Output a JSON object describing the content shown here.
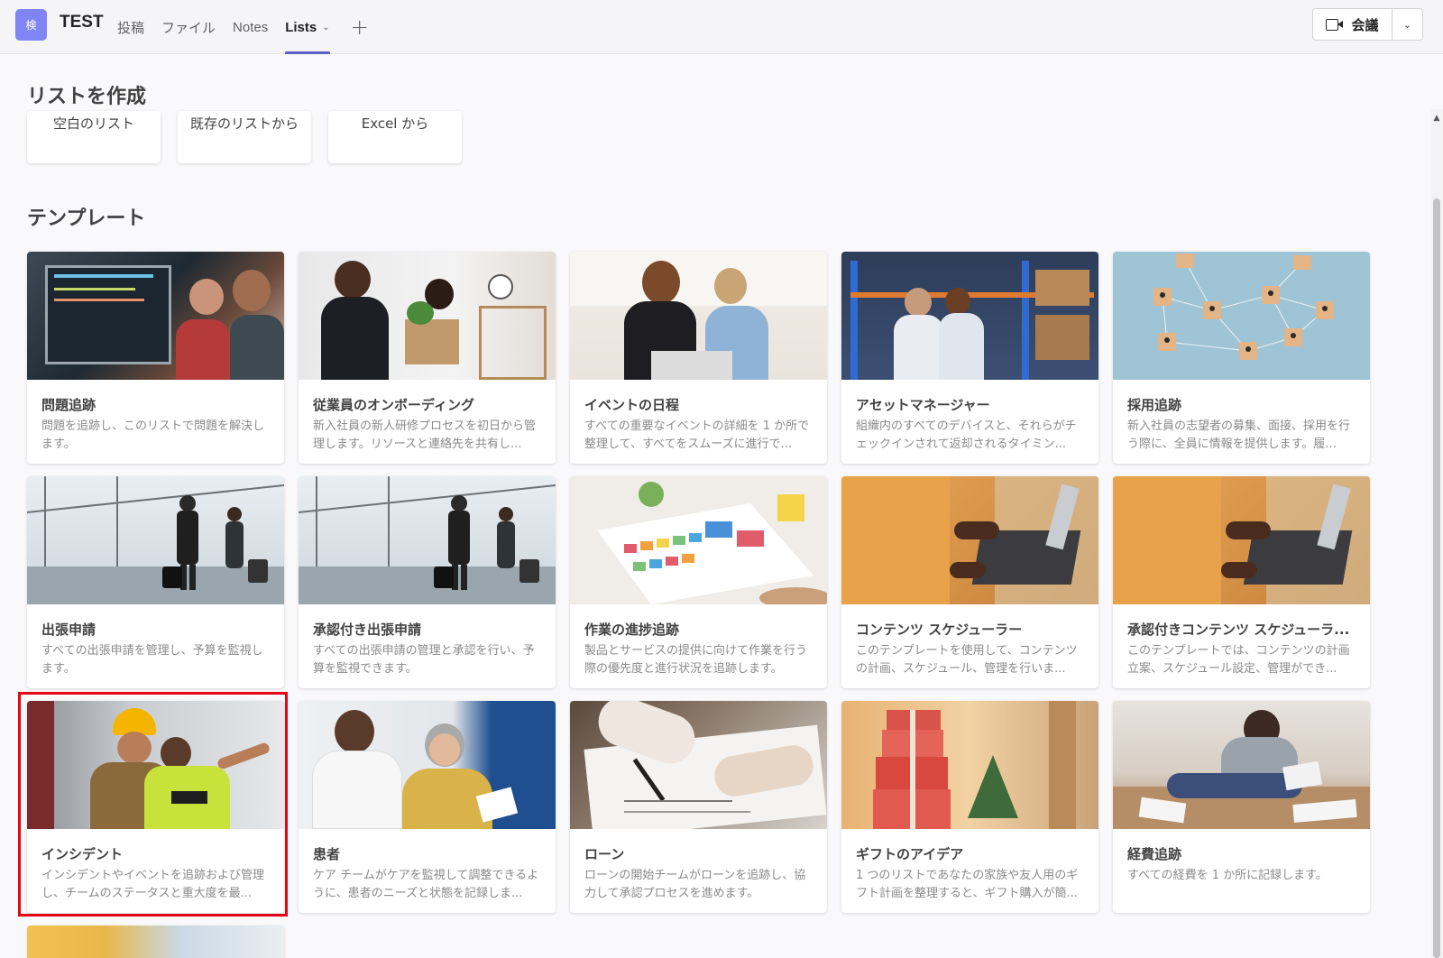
{
  "header": {
    "app_avatar": "検",
    "team_name": "TEST",
    "tabs": [
      {
        "label": "投稿"
      },
      {
        "label": "ファイル"
      },
      {
        "label": "Notes"
      },
      {
        "label": "Lists",
        "active": true
      }
    ],
    "add_tab_icon": "plus-icon",
    "meet_label": "会議"
  },
  "create": {
    "title": "リストを作成",
    "options": [
      "空白のリスト",
      "既存のリストから",
      "Excel から"
    ]
  },
  "templates": {
    "title": "テンプレート",
    "items": [
      {
        "title": "問題追跡",
        "desc": "問題を追跡し、このリストで問題を解決します。"
      },
      {
        "title": "従業員のオンボーディング",
        "desc": "新入社員の新人研修プロセスを初日から管理します。リソースと連絡先を共有し..."
      },
      {
        "title": "イベントの日程",
        "desc": "すべての重要なイベントの詳細を 1 か所で整理して、すべてをスムーズに進行で..."
      },
      {
        "title": "アセットマネージャー",
        "desc": "組織内のすべてのデバイスと、それらがチェックインされて返却されるタイミン..."
      },
      {
        "title": "採用追跡",
        "desc": "新入社員の志望者の募集、面接、採用を行う際に、全員に情報を提供します。履..."
      },
      {
        "title": "出張申請",
        "desc": "すべての出張申請を管理し、予算を監視します。"
      },
      {
        "title": "承認付き出張申請",
        "desc": "すべての出張申請の管理と承認を行い、予算を監視できます。"
      },
      {
        "title": "作業の進捗追跡",
        "desc": "製品とサービスの提供に向けて作業を行う際の優先度と進行状況を追跡します。"
      },
      {
        "title": "コンテンツ スケジューラー",
        "desc": "このテンプレートを使用して、コンテンツの計画、スケジュール、管理を行いま..."
      },
      {
        "title": "承認付きコンテンツ スケジューラ...",
        "desc": "このテンプレートでは、コンテンツの計画立案、スケジュール設定、管理ができ..."
      },
      {
        "title": "インシデント",
        "desc": "インシデントやイベントを追跡および管理し、チームのステータスと重大度を最..."
      },
      {
        "title": "患者",
        "desc": "ケア チームがケアを監視して調整できるように、患者のニーズと状態を記録しま..."
      },
      {
        "title": "ローン",
        "desc": "ローンの開始チームがローンを追跡し、協力して承認プロセスを進めます。"
      },
      {
        "title": "ギフトのアイデア",
        "desc": "1 つのリストであなたの家族や友人用のギフト計画を整理すると、ギフト購入が簡..."
      },
      {
        "title": "経費追跡",
        "desc": "すべての経費を 1 か所に記録します。"
      }
    ]
  },
  "colors": {
    "accent": "#5b5fc7",
    "highlight": "#e30613"
  }
}
